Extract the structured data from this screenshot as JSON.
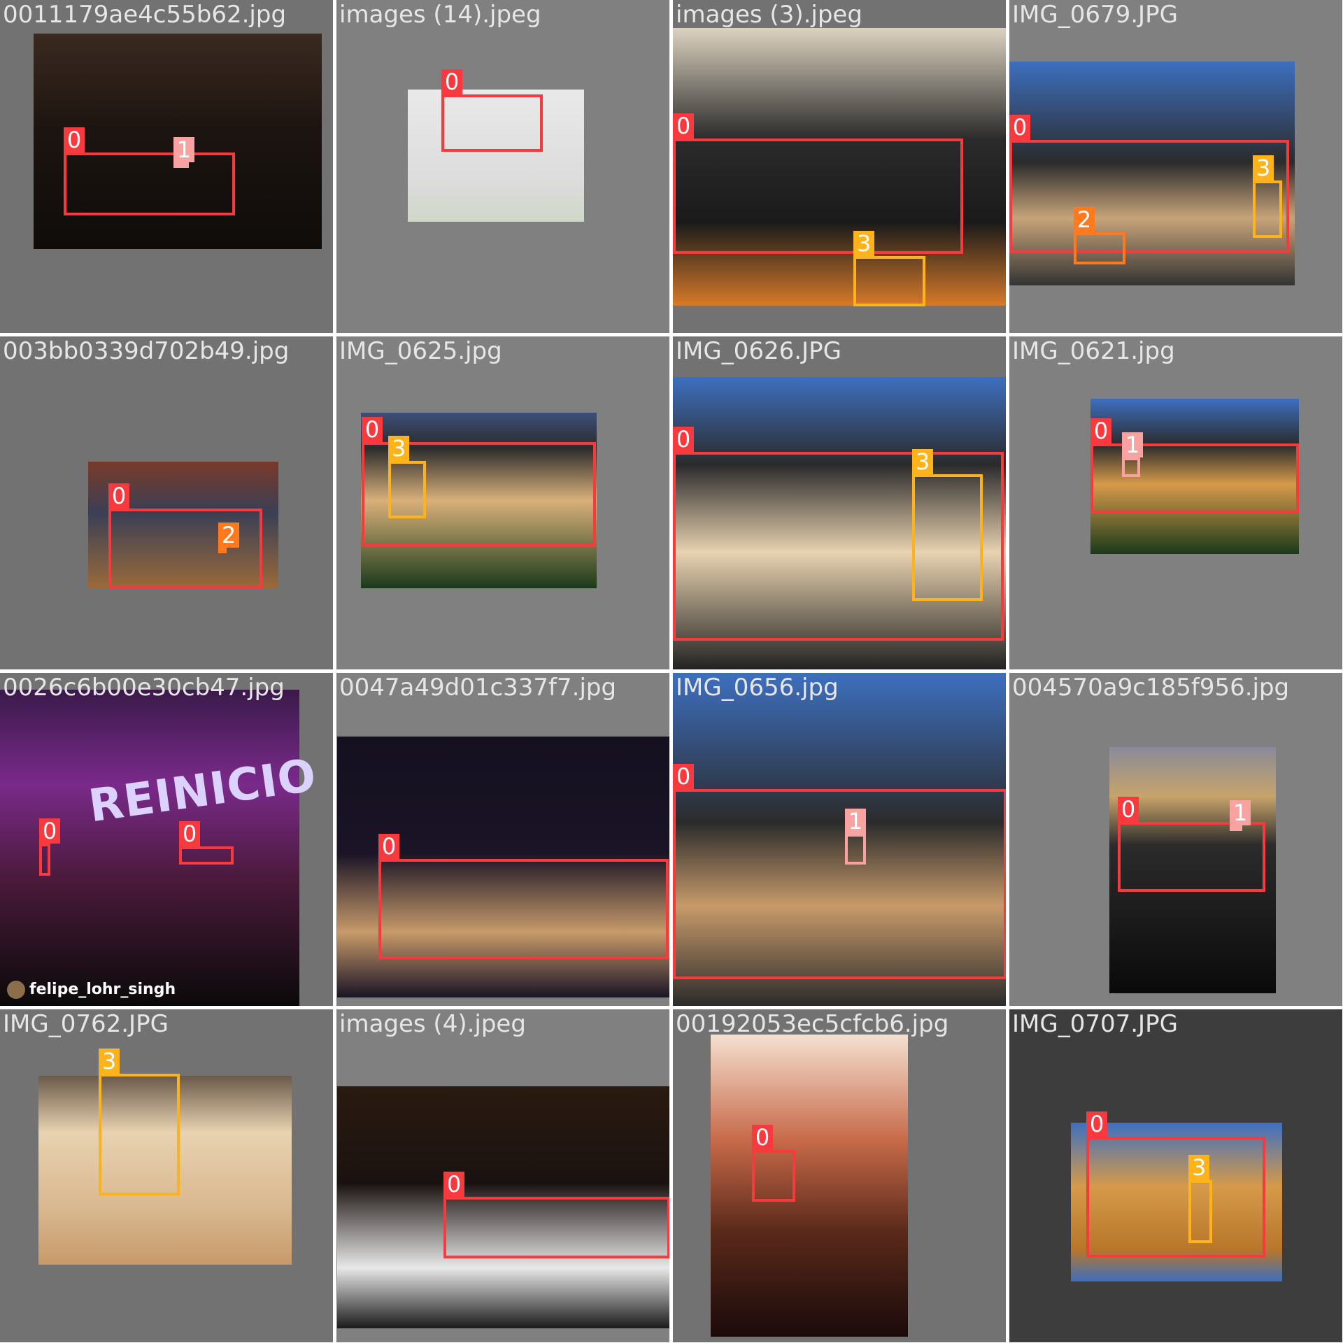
{
  "colors": {
    "class_0": "#f83a3f",
    "class_1": "#f9a2a2",
    "class_2": "#ff7a1f",
    "class_3": "#ffb31a",
    "tile_gray": "#727272",
    "filename_text": "#e6e6e6"
  },
  "tiles": [
    {
      "filename": "0011179ae4c55b62.jpg",
      "labels": [
        "0",
        "1"
      ]
    },
    {
      "filename": "images (14).jpeg",
      "labels": [
        "0"
      ]
    },
    {
      "filename": "images (3).jpeg",
      "labels": [
        "0",
        "3"
      ]
    },
    {
      "filename": "IMG_0679.JPG",
      "labels": [
        "0",
        "3",
        "2"
      ]
    },
    {
      "filename": "003bb0339d702b49.jpg",
      "labels": [
        "0",
        "2"
      ]
    },
    {
      "filename": "IMG_0625.jpg",
      "labels": [
        "0",
        "3"
      ]
    },
    {
      "filename": "IMG_0626.JPG",
      "labels": [
        "0",
        "3"
      ]
    },
    {
      "filename": "IMG_0621.jpg",
      "labels": [
        "0",
        "1"
      ]
    },
    {
      "filename": "0026c6b00e30cb47.jpg",
      "labels": [
        "0",
        "0"
      ],
      "watermark": "felipe_lohr_singh",
      "sign_text": "REINICIO"
    },
    {
      "filename": "0047a49d01c337f7.jpg",
      "labels": [
        "0"
      ]
    },
    {
      "filename": "IMG_0656.jpg",
      "labels": [
        "0",
        "1"
      ]
    },
    {
      "filename": "004570a9c185f956.jpg",
      "labels": [
        "0",
        "1"
      ]
    },
    {
      "filename": "IMG_0762.JPG",
      "labels": [
        "3"
      ]
    },
    {
      "filename": "images (4).jpeg",
      "labels": [
        "0"
      ]
    },
    {
      "filename": "00192053ec5cfcb6.jpg",
      "labels": [
        "0"
      ]
    },
    {
      "filename": "IMG_0707.JPG",
      "labels": [
        "0",
        "3"
      ]
    }
  ]
}
